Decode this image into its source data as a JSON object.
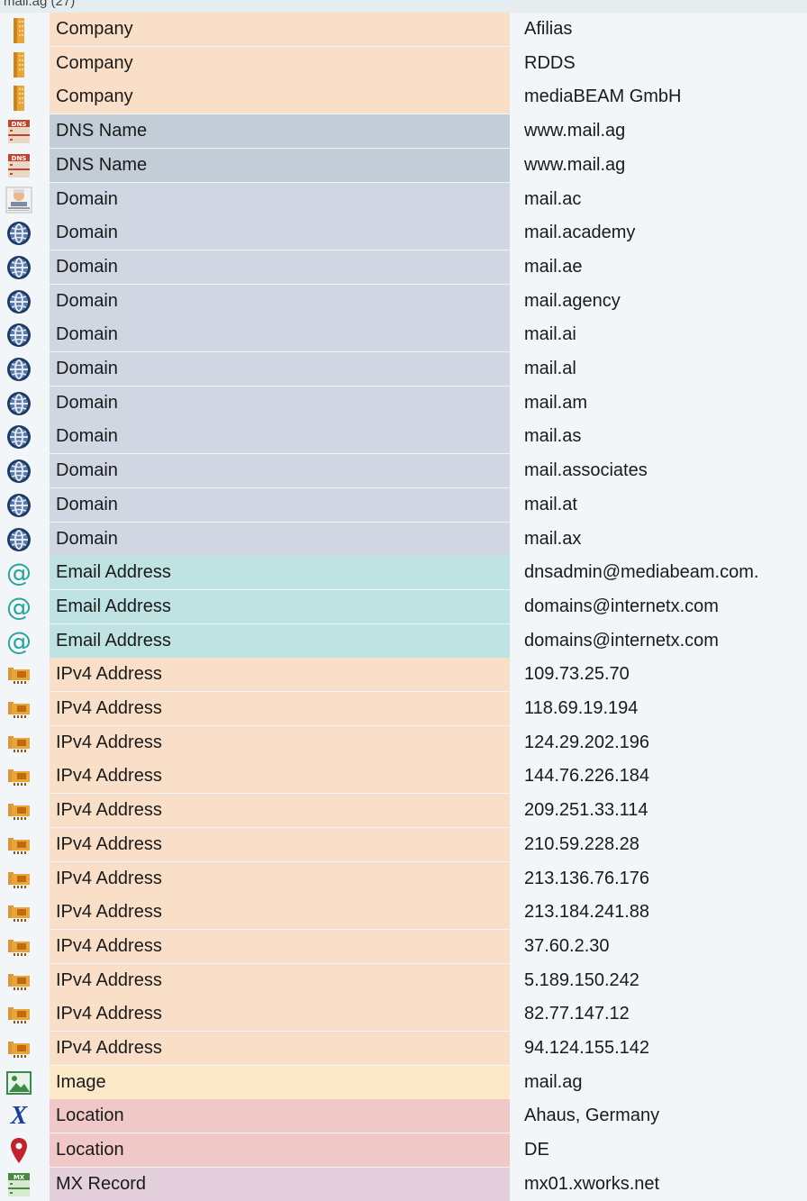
{
  "header": {
    "title": "mail.ag (27)"
  },
  "colors": {
    "Company": "#fadfc8",
    "DNS Name": "#c3cdd8",
    "Domain": "#d0d7e3",
    "Email Address": "#bfe3e3",
    "IPv4 Address": "#fadfc8",
    "Image": "#fbe9c8",
    "Location": "#f0c8c8",
    "MX Record": "#e3d0dc"
  },
  "rows": [
    {
      "type": "Company",
      "value": "Afilias",
      "icon": "building-icon"
    },
    {
      "type": "Company",
      "value": "RDDS",
      "icon": "building-icon"
    },
    {
      "type": "Company",
      "value": "mediaBEAM GmbH",
      "icon": "building-icon"
    },
    {
      "type": "DNS Name",
      "value": "www.mail.ag",
      "icon": "dns-server-icon"
    },
    {
      "type": "DNS Name",
      "value": "www.mail.ag",
      "icon": "dns-server-icon"
    },
    {
      "type": "Domain",
      "value": "mail.ac",
      "icon": "person-avatar-icon"
    },
    {
      "type": "Domain",
      "value": "mail.academy",
      "icon": "globe-icon"
    },
    {
      "type": "Domain",
      "value": "mail.ae",
      "icon": "globe-icon"
    },
    {
      "type": "Domain",
      "value": "mail.agency",
      "icon": "globe-icon"
    },
    {
      "type": "Domain",
      "value": "mail.ai",
      "icon": "globe-icon"
    },
    {
      "type": "Domain",
      "value": "mail.al",
      "icon": "globe-icon"
    },
    {
      "type": "Domain",
      "value": "mail.am",
      "icon": "globe-icon"
    },
    {
      "type": "Domain",
      "value": "mail.as",
      "icon": "globe-icon"
    },
    {
      "type": "Domain",
      "value": "mail.associates",
      "icon": "globe-icon"
    },
    {
      "type": "Domain",
      "value": "mail.at",
      "icon": "globe-icon"
    },
    {
      "type": "Domain",
      "value": "mail.ax",
      "icon": "globe-icon"
    },
    {
      "type": "Email Address",
      "value": "dnsadmin@mediabeam.com.",
      "icon": "at-sign-icon"
    },
    {
      "type": "Email Address",
      "value": "domains@internetx.com",
      "icon": "at-sign-icon"
    },
    {
      "type": "Email Address",
      "value": "domains@internetx.com",
      "icon": "at-sign-icon"
    },
    {
      "type": "IPv4 Address",
      "value": "109.73.25.70",
      "icon": "network-card-icon"
    },
    {
      "type": "IPv4 Address",
      "value": "118.69.19.194",
      "icon": "network-card-icon"
    },
    {
      "type": "IPv4 Address",
      "value": "124.29.202.196",
      "icon": "network-card-icon"
    },
    {
      "type": "IPv4 Address",
      "value": "144.76.226.184",
      "icon": "network-card-icon"
    },
    {
      "type": "IPv4 Address",
      "value": "209.251.33.114",
      "icon": "network-card-icon"
    },
    {
      "type": "IPv4 Address",
      "value": "210.59.228.28",
      "icon": "network-card-icon"
    },
    {
      "type": "IPv4 Address",
      "value": "213.136.76.176",
      "icon": "network-card-icon"
    },
    {
      "type": "IPv4 Address",
      "value": "213.184.241.88",
      "icon": "network-card-icon"
    },
    {
      "type": "IPv4 Address",
      "value": "37.60.2.30",
      "icon": "network-card-icon"
    },
    {
      "type": "IPv4 Address",
      "value": "5.189.150.242",
      "icon": "network-card-icon"
    },
    {
      "type": "IPv4 Address",
      "value": "82.77.147.12",
      "icon": "network-card-icon"
    },
    {
      "type": "IPv4 Address",
      "value": "94.124.155.142",
      "icon": "network-card-icon"
    },
    {
      "type": "Image",
      "value": "mail.ag",
      "icon": "image-icon"
    },
    {
      "type": "Location",
      "value": "Ahaus, Germany",
      "icon": "x-logo-icon"
    },
    {
      "type": "Location",
      "value": "DE",
      "icon": "map-pin-icon"
    },
    {
      "type": "MX Record",
      "value": "mx01.xworks.net",
      "icon": "mx-server-icon"
    }
  ]
}
